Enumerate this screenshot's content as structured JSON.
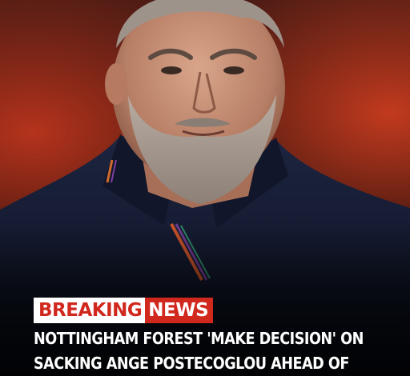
{
  "tag": {
    "breaking": "BREAKING",
    "news": "NEWS"
  },
  "headline": "NOTTINGHAM FOREST 'MAKE DECISION' ON SACKING ANGE POSTECOGLOU AHEAD OF",
  "colors": {
    "accent_red": "#d1281e",
    "shirt_navy": "#141a2e",
    "background_red": "#b5331c"
  }
}
